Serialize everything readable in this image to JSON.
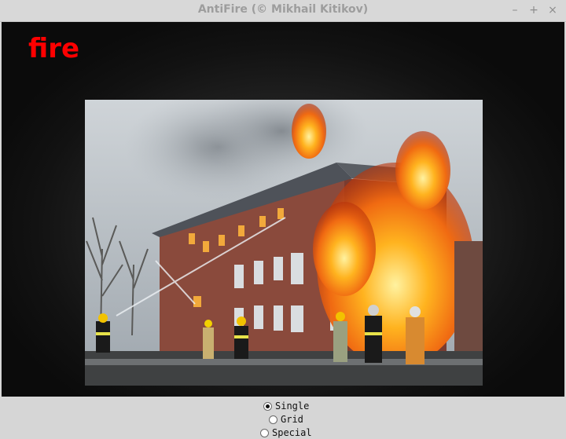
{
  "window": {
    "title": "AntiFire (© Mikhail Kitikov)",
    "controls": {
      "minimize": "–",
      "maximize": "+",
      "close": "×"
    }
  },
  "view": {
    "detection_label": "fire",
    "detection_label_color": "#ff0000",
    "image_icon": "burning-building-photo"
  },
  "modes": {
    "options": [
      {
        "label": "Single",
        "selected": true
      },
      {
        "label": "Grid",
        "selected": false
      },
      {
        "label": "Special",
        "selected": false
      }
    ]
  }
}
